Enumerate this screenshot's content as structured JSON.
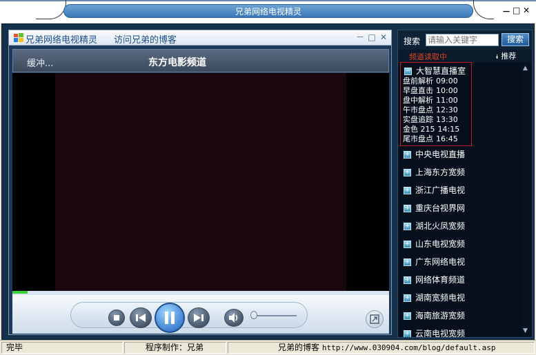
{
  "window": {
    "title": "兄弟网络电视精灵",
    "minimize": "－",
    "maximize": "□",
    "close": "✕"
  },
  "player": {
    "header_title": "兄弟网络电视精灵",
    "blog_link": "访问兄弟的博客",
    "status_text": "缓冲...",
    "channel_name": "东方电影频道",
    "buffer_progress": 0.04,
    "volume_level": 0.0
  },
  "sidebar": {
    "search_label": "搜索",
    "search_placeholder": "请输入关键字",
    "search_button": "搜索",
    "reading_channels": "频道读取中",
    "recommend": "推荐",
    "featured_group": {
      "name": "大智慧直播室",
      "schedule": [
        {
          "name": "盘前解析",
          "time": "09:00"
        },
        {
          "name": "早盘直击",
          "time": "10:00"
        },
        {
          "name": "盘中解析",
          "time": "11:00"
        },
        {
          "name": "午市盘点",
          "time": "12:30"
        },
        {
          "name": "实盘追踪",
          "time": "13:30"
        },
        {
          "name": "金色 215",
          "time": "14:15"
        },
        {
          "name": "尾市盘点",
          "time": "16:45"
        }
      ]
    },
    "channels": [
      "中央电视直播",
      "上海东方宽频",
      "浙江广播电视",
      "重庆台视界网",
      "湖北火凤宽频",
      "山东电视宽频",
      "广东网络电视",
      "网络体育频道",
      "湖南宽频电视",
      "海南旅游宽频",
      "云南电视宽频"
    ]
  },
  "statusbar": {
    "state": "完毕",
    "author": "程序制作：兄弟",
    "blog_label": "兄弟的博客",
    "blog_url": "http://www.030904.com/blog/default.asp"
  }
}
